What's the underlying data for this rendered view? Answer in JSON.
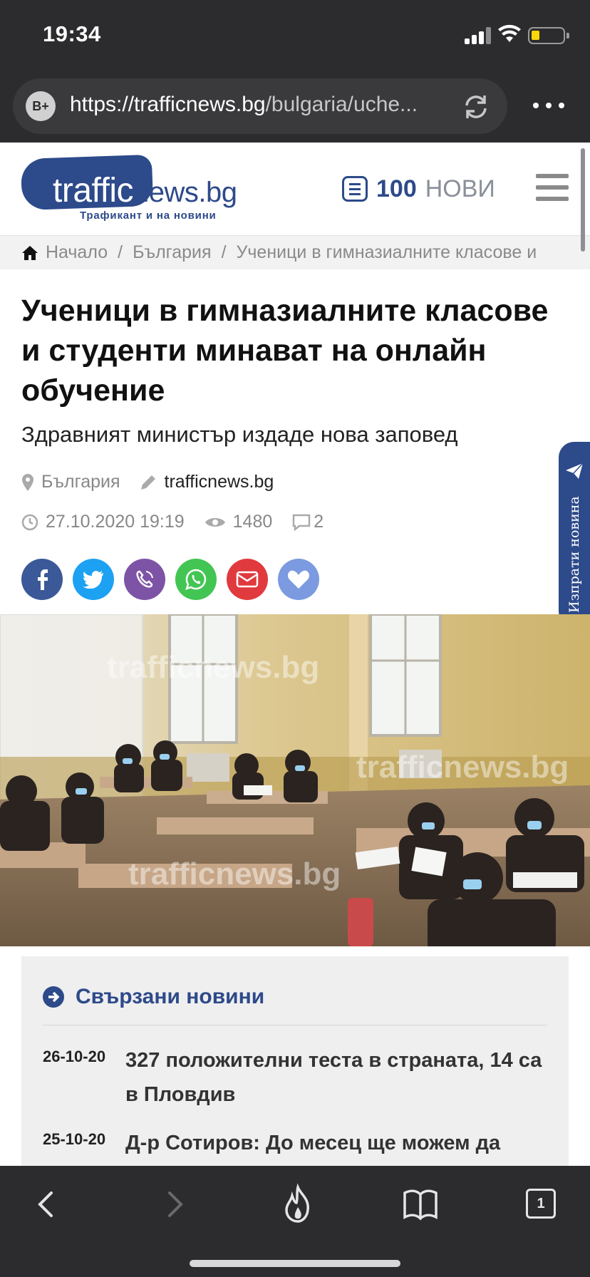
{
  "status_bar": {
    "time": "19:34"
  },
  "browser": {
    "url_domain": "https://trafficnews.bg",
    "url_path": "/bulgaria/uche...",
    "tab_count": "1"
  },
  "site": {
    "logo_word": "traffic",
    "logo_suffix": "news.bg",
    "tagline": "Трафикант и на новини",
    "news_count": "100",
    "news_label": "НОВИ"
  },
  "breadcrumb": {
    "home": "Начало",
    "sep": "/",
    "category": "България",
    "current": "Ученици в гимназиалните класове и"
  },
  "article": {
    "title": "Ученици в гимназиалните класове и студенти минават на онлайн обучение",
    "subtitle": "Здравният министър издаде нова заповед",
    "location": "България",
    "author": "trafficnews.bg",
    "datetime": "27.10.2020 19:19",
    "views": "1480",
    "comments": "2"
  },
  "send_tab": {
    "label": "Изпрати новина"
  },
  "photo": {
    "watermark": "trafficnews.bg"
  },
  "related": {
    "heading": "Свързани новини",
    "items": [
      {
        "date": "26-10-20",
        "title": "327 положителни теста в страната, 14 са в Пловдив"
      },
      {
        "date": "25-10-20",
        "title": "Д-р Сотиров: До месец ще можем да"
      }
    ]
  },
  "colors": {
    "brand": "#2d4a8a",
    "facebook": "#3b5998",
    "twitter": "#1da1f2",
    "viber": "#7d53a6",
    "whatsapp": "#43c553",
    "email": "#e03a3e",
    "favorite": "#7b9ae0"
  }
}
